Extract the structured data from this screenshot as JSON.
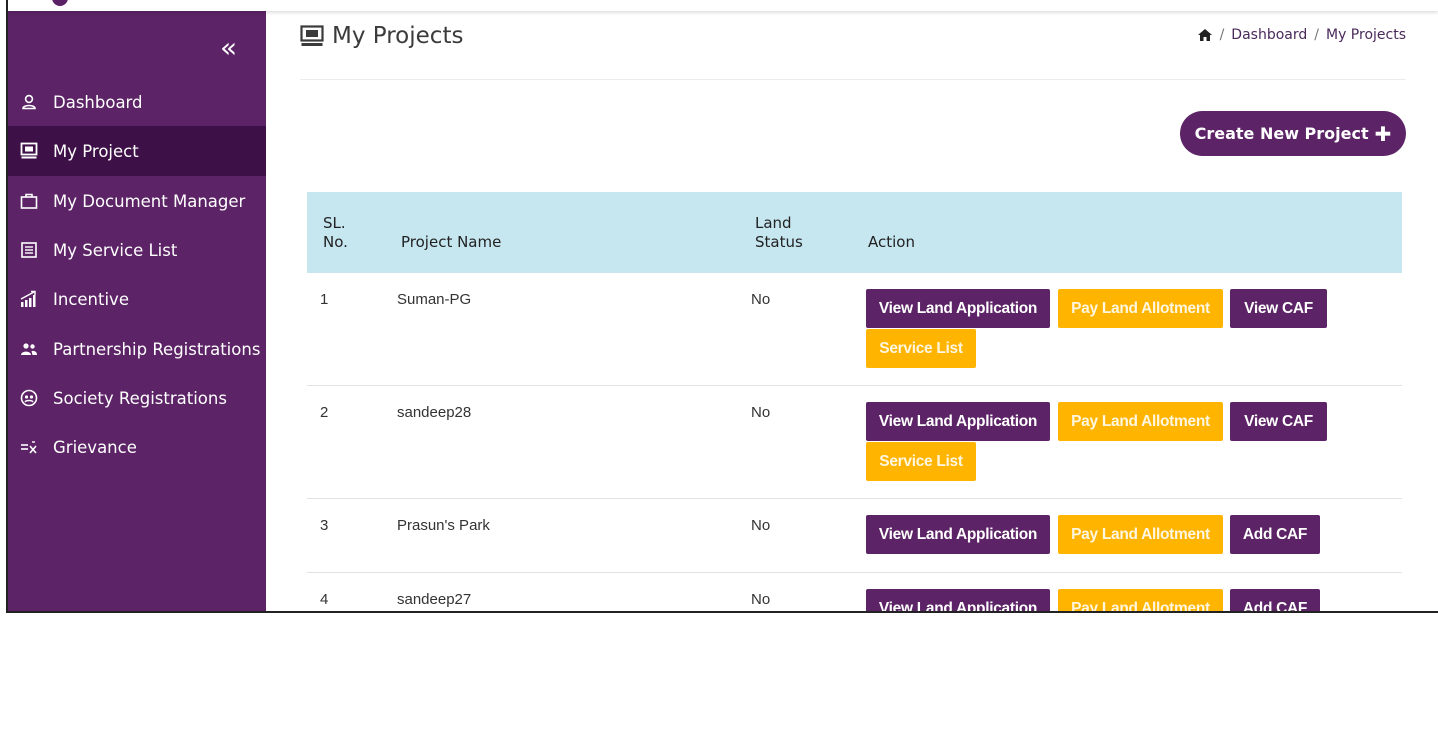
{
  "page": {
    "title": "My Projects",
    "breadcrumb": [
      "Dashboard",
      "My Projects"
    ],
    "create_button": "Create New Project",
    "create_button_icon": "plus-icon"
  },
  "sidebar": {
    "collapse_icon": "double-chevron-left-icon",
    "items": [
      {
        "label": "Dashboard",
        "icon": "user-icon",
        "active": false
      },
      {
        "label": "My Project",
        "icon": "screen-icon",
        "active": true
      },
      {
        "label": "My Document Manager",
        "icon": "briefcase-icon",
        "active": false
      },
      {
        "label": "My Service List",
        "icon": "list-icon",
        "active": false
      },
      {
        "label": "Incentive",
        "icon": "growth-chart-icon",
        "active": false
      },
      {
        "label": "Partnership Registrations",
        "icon": "group-icon",
        "active": false
      },
      {
        "label": "Society Registrations",
        "icon": "society-icon",
        "active": false
      },
      {
        "label": "Grievance",
        "icon": "grievance-icon",
        "active": false
      }
    ]
  },
  "table": {
    "headers": {
      "sl_line1": "SL.",
      "sl_line2": "No.",
      "name": "Project Name",
      "land_line1": "Land",
      "land_line2": "Status",
      "action": "Action"
    },
    "rows": [
      {
        "sl": "1",
        "name": "Suman-PG",
        "land": "No",
        "b1": "View Land Application",
        "b2": "Pay Land Allotment",
        "b3": "View CAF",
        "b4": "Service List"
      },
      {
        "sl": "2",
        "name": "sandeep28",
        "land": "No",
        "b1": "View Land Application",
        "b2": "Pay Land Allotment",
        "b3": "View CAF",
        "b4": "Service List"
      },
      {
        "sl": "3",
        "name": "Prasun's Park",
        "land": "No",
        "b1": "View Land Application",
        "b2": "Pay Land Allotment",
        "b3": "Add CAF"
      },
      {
        "sl": "4",
        "name": "sandeep27",
        "land": "No",
        "b1": "View Land Application",
        "b2": "Pay Land Allotment",
        "b3": "Add CAF"
      }
    ]
  },
  "colors": {
    "primary": "#5c2366",
    "active": "#3d1147",
    "accent": "#ffb400",
    "table_header": "#c6e6f0"
  }
}
